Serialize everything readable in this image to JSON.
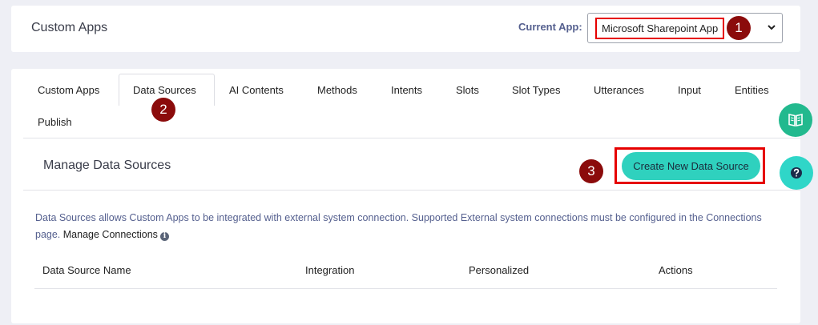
{
  "header": {
    "title": "Custom Apps",
    "current_app_label": "Current App:",
    "current_app_value": "Microsoft Sharepoint App"
  },
  "tabs": [
    {
      "label": "Custom Apps"
    },
    {
      "label": "Data Sources",
      "active": true
    },
    {
      "label": "AI Contents"
    },
    {
      "label": "Methods"
    },
    {
      "label": "Intents"
    },
    {
      "label": "Slots"
    },
    {
      "label": "Slot Types"
    },
    {
      "label": "Utterances"
    },
    {
      "label": "Input"
    },
    {
      "label": "Entities"
    },
    {
      "label": "Publish"
    }
  ],
  "section": {
    "title": "Manage Data Sources",
    "create_button_label": "Create New Data Source"
  },
  "info": {
    "text": "Data Sources allows Custom Apps to be integrated with external system connection. Supported External system connections must be configured in the Connections page.",
    "manage_link": "Manage Connections",
    "info_icon": "i"
  },
  "table": {
    "headers": [
      "Data Source Name",
      "Integration",
      "Personalized",
      "Actions"
    ]
  },
  "annotations": [
    "1",
    "2",
    "3"
  ],
  "icons": {
    "chevron": "chevron-down-icon",
    "guide": "book-icon",
    "help": "question-circle-icon",
    "info": "info-icon"
  },
  "colors": {
    "accent": "#2fd1be",
    "highlight": "#e60000",
    "badge": "#8b0b0b",
    "guide_button": "#22b98e",
    "help_button": "#2fd6c8",
    "info_text": "#55608f"
  }
}
